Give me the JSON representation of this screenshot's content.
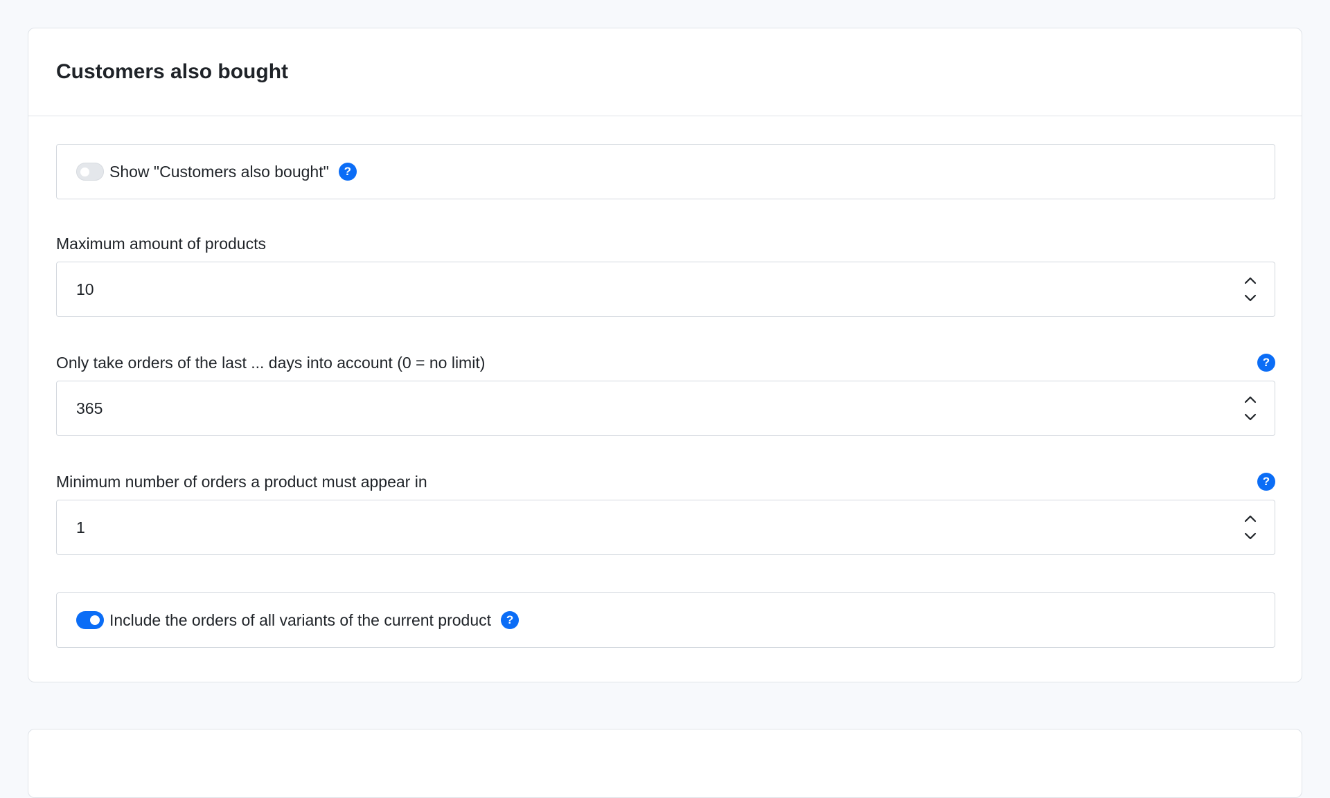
{
  "card": {
    "title": "Customers also bought",
    "show_toggle": {
      "label": "Show \"Customers also bought\"",
      "checked": false,
      "help_icon": "help-icon"
    },
    "max_products": {
      "label": "Maximum amount of products",
      "value": "10"
    },
    "days_limit": {
      "label": "Only take orders of the last ... days into account (0 = no limit)",
      "value": "365",
      "help_icon": "help-icon"
    },
    "min_orders": {
      "label": "Minimum number of orders a product must appear in",
      "value": "1",
      "help_icon": "help-icon"
    },
    "variants_toggle": {
      "label": "Include the orders of all variants of the current product",
      "checked": true,
      "help_icon": "help-icon"
    }
  },
  "colors": {
    "accent": "#0b6df6",
    "background": "#f7f9fc",
    "border": "#d3d8de"
  }
}
